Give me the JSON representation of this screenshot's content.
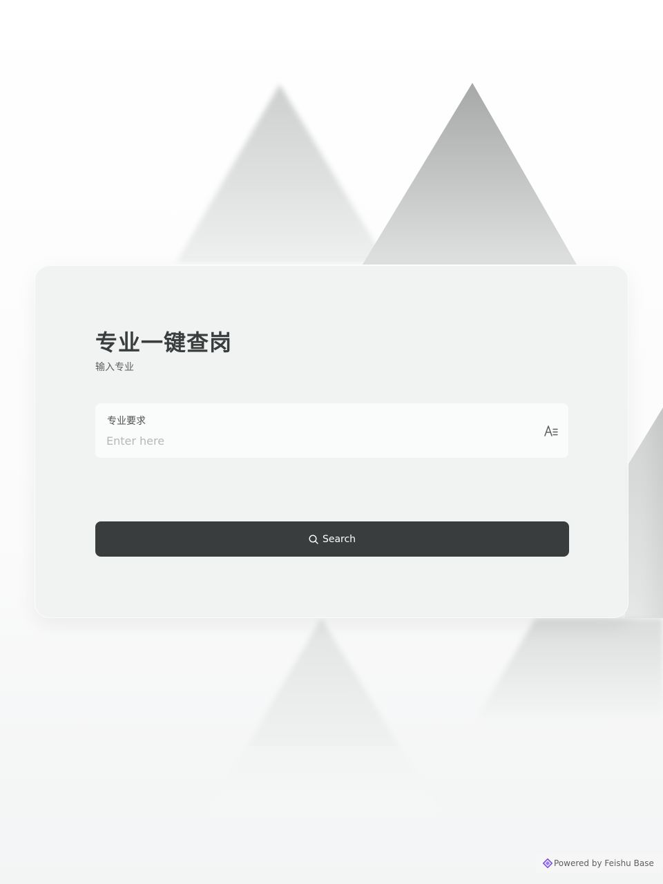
{
  "form": {
    "title": "专业一键查岗",
    "subtitle": "输入专业",
    "field": {
      "label": "专业要求",
      "placeholder": "Enter here",
      "value": "",
      "type_icon": "text-type-icon"
    },
    "search_button": {
      "label": "Search",
      "icon": "search-icon"
    }
  },
  "footer": {
    "powered_by": "Powered by Feishu Base",
    "logo_icon": "feishu-base-logo-icon"
  },
  "colors": {
    "button_bg": "#3a3d3d",
    "title_text": "#3a3d3d",
    "logo_accent": "#7b4ce0"
  }
}
